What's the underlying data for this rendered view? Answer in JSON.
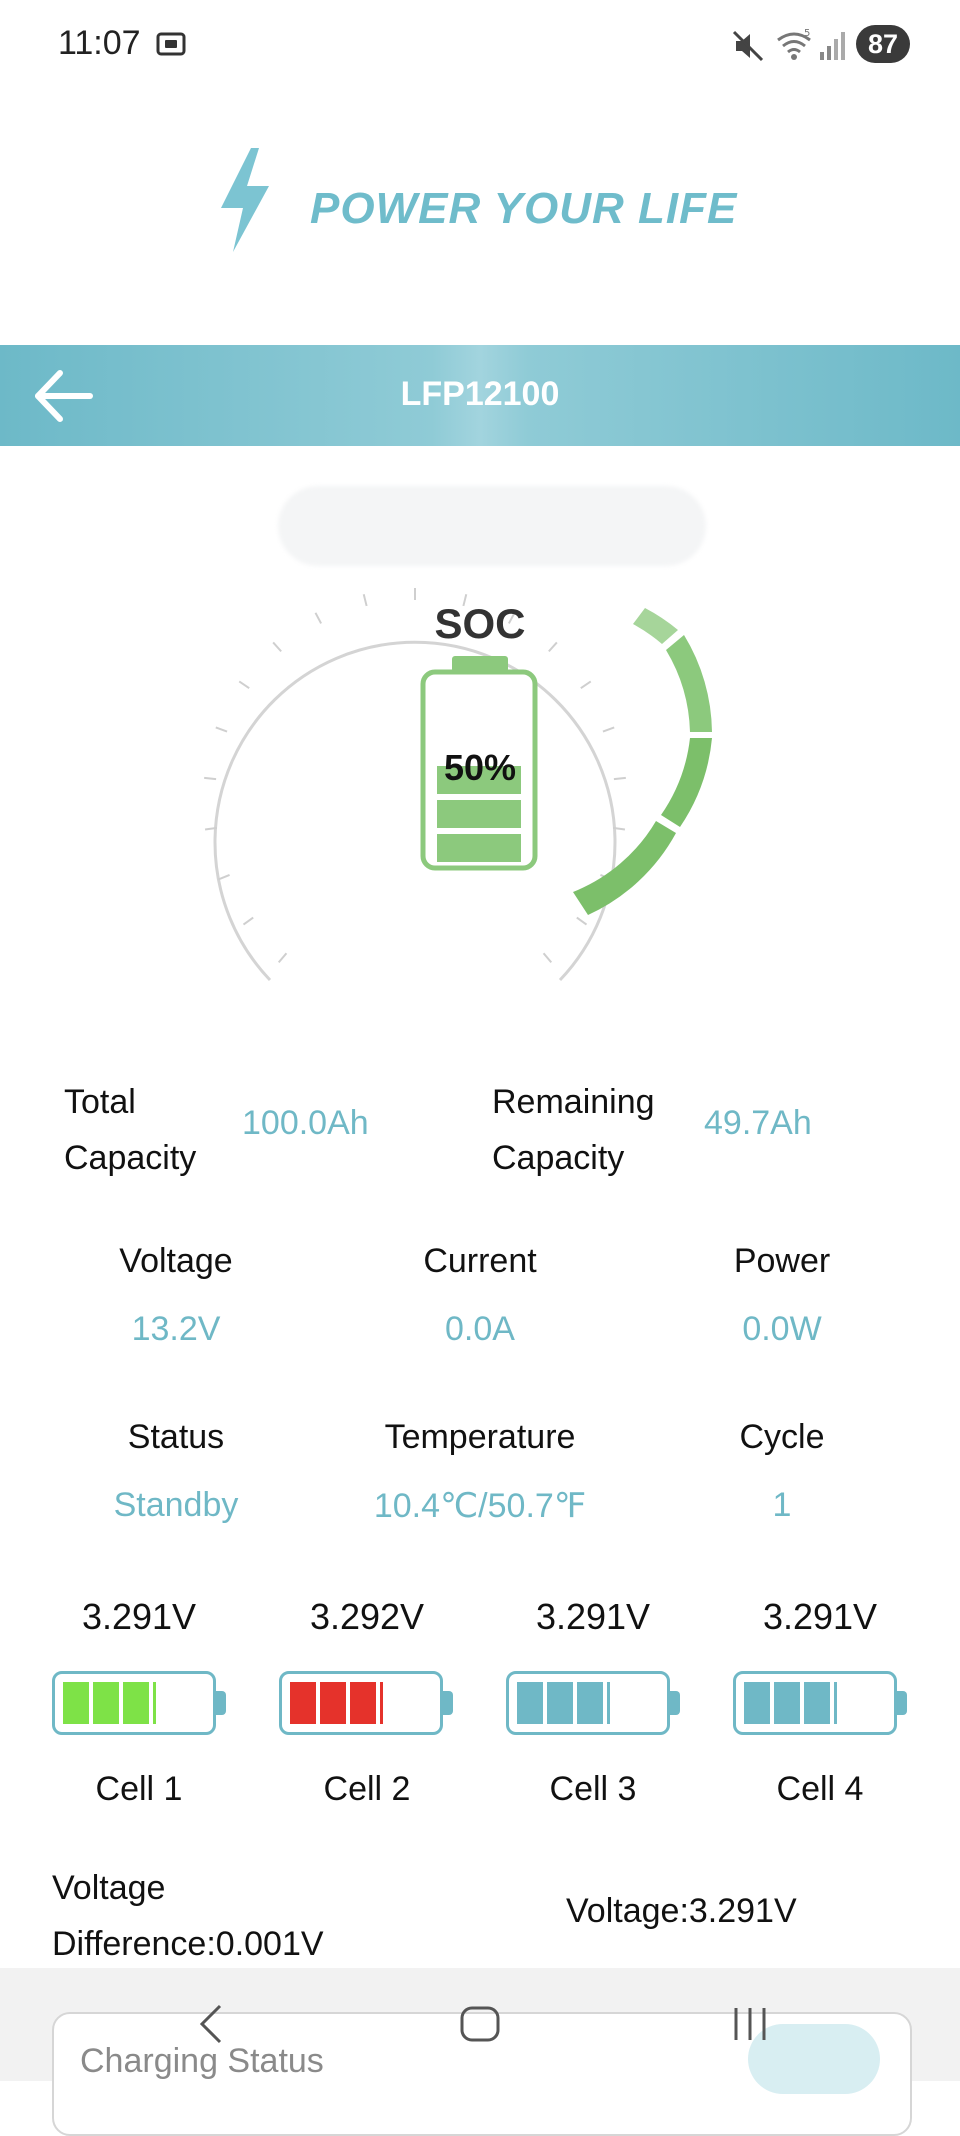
{
  "status_bar": {
    "time": "11:07",
    "battery": "87",
    "icons": [
      "screen-record-icon",
      "mute-icon",
      "wifi-icon",
      "signal-icon"
    ]
  },
  "brand": {
    "tagline": "POWER YOUR LIFE"
  },
  "header": {
    "title": "LFP12100"
  },
  "soc": {
    "label": "SOC",
    "value_text": "50%",
    "level": 0.5
  },
  "capacity": {
    "total_label_1": "Total",
    "total_label_2": "Capacity",
    "total_value": "100.0Ah",
    "remaining_label_1": "Remaining",
    "remaining_label_2": "Capacity",
    "remaining_value": "49.7Ah"
  },
  "metrics_row1": [
    {
      "label": "Voltage",
      "value": "13.2V"
    },
    {
      "label": "Current",
      "value": "0.0A"
    },
    {
      "label": "Power",
      "value": "0.0W"
    }
  ],
  "metrics_row2": [
    {
      "label": "Status",
      "value": "Standby"
    },
    {
      "label": "Temperature",
      "value": "10.4℃/50.7℉"
    },
    {
      "label": "Cycle",
      "value": "1"
    }
  ],
  "cells": [
    {
      "voltage": "3.291V",
      "name": "Cell 1",
      "color": "#7ee247"
    },
    {
      "voltage": "3.292V",
      "name": "Cell 2",
      "color": "#e5322b"
    },
    {
      "voltage": "3.291V",
      "name": "Cell 3",
      "color": "#6fb8c6"
    },
    {
      "voltage": "3.291V",
      "name": "Cell 4",
      "color": "#6fb8c6"
    }
  ],
  "summary": {
    "voltage_difference_line1": "Voltage",
    "voltage_difference_line2": "Difference:0.001V",
    "voltage": "Voltage:3.291V"
  },
  "charging": {
    "label": "Charging Status",
    "enabled": true
  },
  "colors": {
    "accent": "#6fb8c6",
    "gauge_green": "#7cbf6a",
    "header": "#6db9c8"
  }
}
